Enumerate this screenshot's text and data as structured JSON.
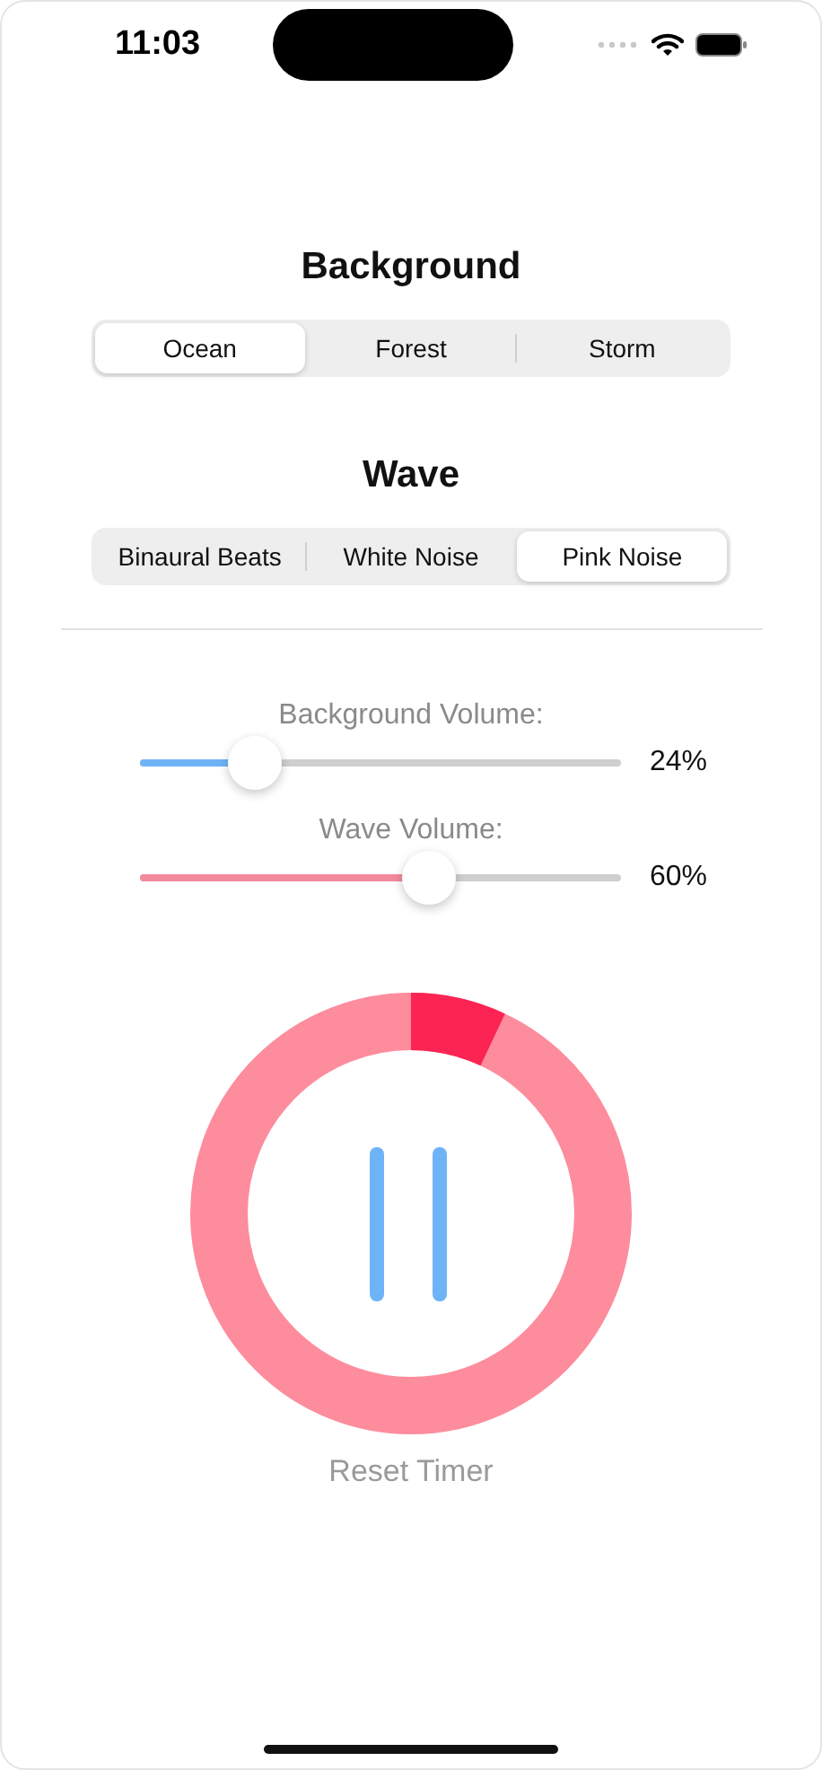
{
  "status_bar": {
    "time": "11:03"
  },
  "background": {
    "title": "Background",
    "options": [
      {
        "label": "Ocean",
        "selected": true
      },
      {
        "label": "Forest",
        "selected": false
      },
      {
        "label": "Storm",
        "selected": false
      }
    ]
  },
  "wave": {
    "title": "Wave",
    "options": [
      {
        "label": "Binaural Beats",
        "selected": false
      },
      {
        "label": "White Noise",
        "selected": false
      },
      {
        "label": "Pink Noise",
        "selected": true
      }
    ]
  },
  "sliders": [
    {
      "label": "Background Volume:",
      "level": 0.24,
      "reading": "24%",
      "color": "#6fb3f7"
    },
    {
      "label": "Wave Volume:",
      "level": 0.6,
      "reading": "60%",
      "color": "#f38a9b"
    }
  ],
  "timer": {
    "level": 0.07,
    "playing": true,
    "button": "Reset Timer"
  }
}
